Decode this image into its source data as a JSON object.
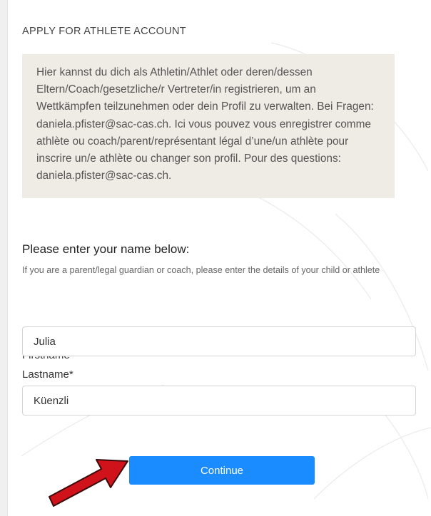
{
  "form": {
    "section_title": "APPLY FOR ATHLETE ACCOUNT",
    "info_text": "Hier kannst du dich als Athletin/Athlet oder deren/dessen Eltern/Coach/gesetzliche/r Vertreter/in registrieren, um an Wettkämpfen teilzunehmen oder dein Profil zu verwalten. Bei Fragen: daniela.pfister@sac-cas.ch. Ici vous pouvez vous enregistrer comme athlète ou coach/parent/représentant légal d’une/un athlète pour inscrire un/e athlète ou changer son profil. Pour des questions: daniela.pfister@sac-cas.ch.",
    "prompt": "Please enter your name below:",
    "hint": "If you are a parent/legal guardian or coach, please enter the details of your child or athlete",
    "firstname_label": "Firstname*",
    "firstname_value": "Julia",
    "lastname_label": "Lastname*",
    "lastname_value": "Küenzli",
    "continue_label": "Continue"
  },
  "colors": {
    "info_bg": "#efebe5",
    "button": "#1a8cff",
    "arrow": "#d0121b"
  },
  "icons": {
    "annotation": "red-arrow-icon"
  }
}
